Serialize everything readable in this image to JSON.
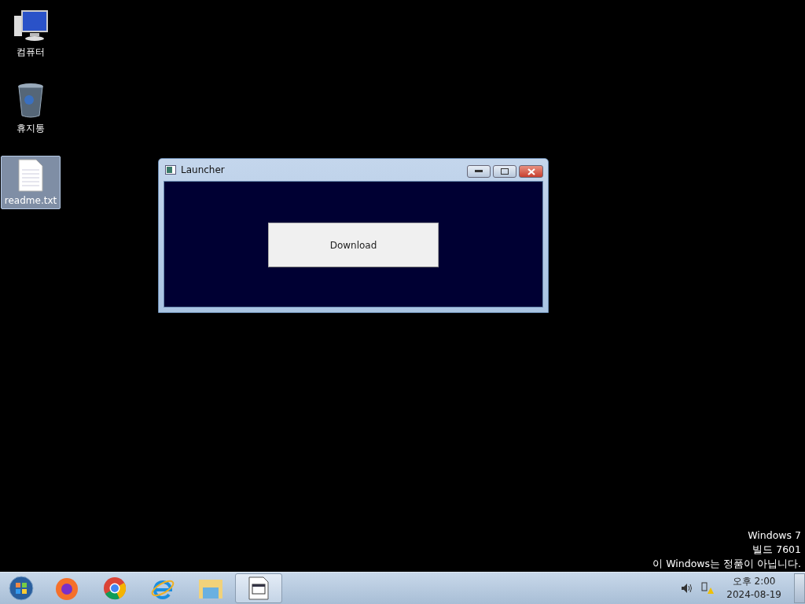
{
  "desktop_icons": [
    {
      "label": "컴퓨터",
      "kind": "computer",
      "selected": false
    },
    {
      "label": "휴지통",
      "kind": "recycle",
      "selected": false
    },
    {
      "label": "readme.txt",
      "kind": "file",
      "selected": true
    }
  ],
  "window": {
    "title": "Launcher",
    "button": "Download"
  },
  "watermark_lines": [
    "Windows 7",
    "빌드 7601",
    "이 Windows는 정품이 아닙니다."
  ],
  "taskbar": {
    "items": [
      {
        "kind": "firefox",
        "selected": false
      },
      {
        "kind": "chrome",
        "selected": false
      },
      {
        "kind": "ie",
        "selected": false
      },
      {
        "kind": "explorer",
        "selected": false
      },
      {
        "kind": "app",
        "selected": true
      }
    ],
    "clock": {
      "time": "오후 2:00",
      "date": "2024-08-19"
    }
  }
}
